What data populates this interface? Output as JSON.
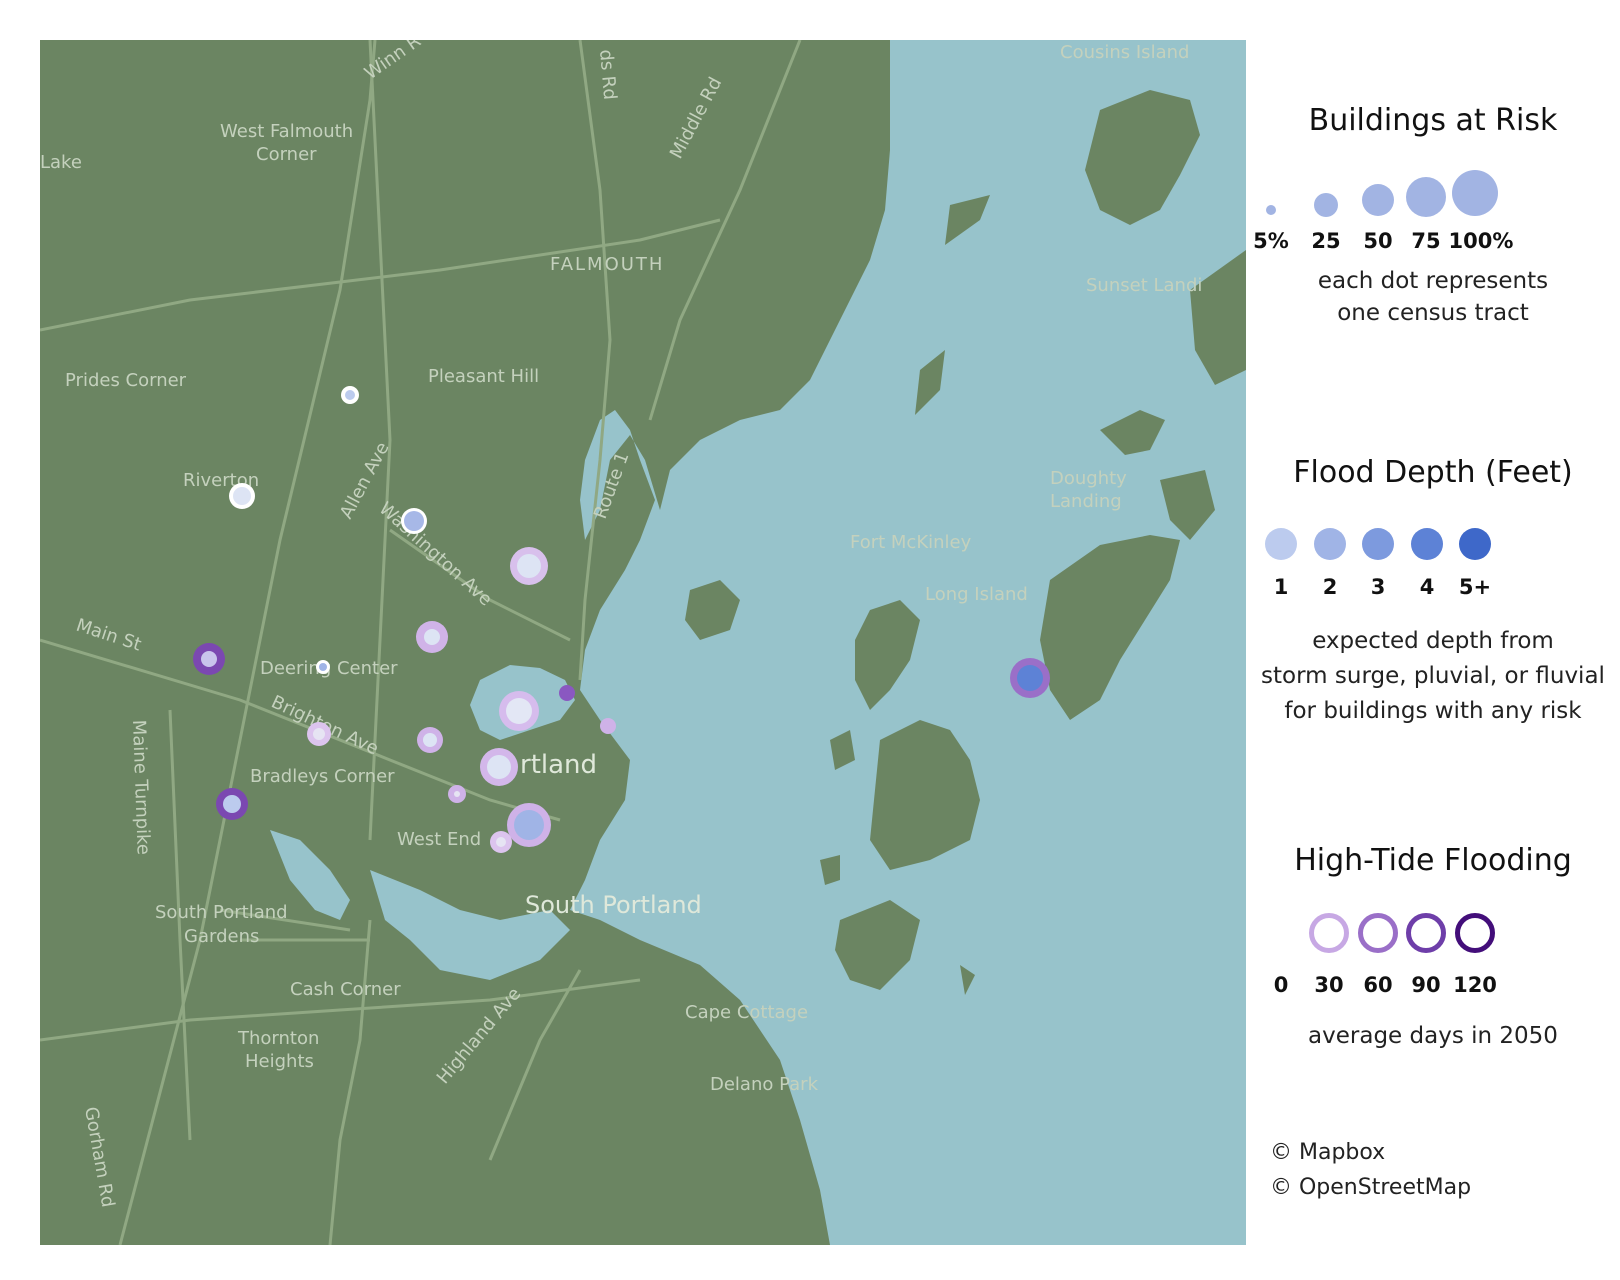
{
  "map": {
    "colors": {
      "land": "#6b8562",
      "water": "#97c3cb",
      "road": "#90a883",
      "label": "#c4d1bd"
    },
    "place_labels": [
      {
        "id": "winn",
        "text": "Winn R"
      },
      {
        "id": "ds-rd",
        "text": "ds Rd"
      },
      {
        "id": "middle-rd",
        "text": "Middle Rd"
      },
      {
        "id": "cousins",
        "text": "Cousins Island"
      },
      {
        "id": "west-falmouth-1",
        "text": "West Falmouth"
      },
      {
        "id": "west-falmouth-2",
        "text": "Corner"
      },
      {
        "id": "lake",
        "text": "Lake"
      },
      {
        "id": "falmouth",
        "text": "FALMOUTH"
      },
      {
        "id": "sunset",
        "text": "Sunset Landi"
      },
      {
        "id": "prides",
        "text": "Prides Corner"
      },
      {
        "id": "pleasant-hill",
        "text": "Pleasant Hill"
      },
      {
        "id": "riverton",
        "text": "Riverton"
      },
      {
        "id": "allen-ave",
        "text": "Allen Ave"
      },
      {
        "id": "washington-ave",
        "text": "Washington Ave"
      },
      {
        "id": "route-1",
        "text": "Route 1"
      },
      {
        "id": "doughty-1",
        "text": "Doughty"
      },
      {
        "id": "doughty-2",
        "text": "Landing"
      },
      {
        "id": "fort-mckinley",
        "text": "Fort McKinley"
      },
      {
        "id": "long-island",
        "text": "Long Island"
      },
      {
        "id": "main-st",
        "text": "Main St"
      },
      {
        "id": "deering",
        "text": "Deering Center"
      },
      {
        "id": "brighton",
        "text": "Brighton Ave"
      },
      {
        "id": "maine-turnpike",
        "text": "Maine Turnpike"
      },
      {
        "id": "portland",
        "text": "rtland"
      },
      {
        "id": "bradleys",
        "text": "Bradleys Corner"
      },
      {
        "id": "west-end",
        "text": "West End"
      },
      {
        "id": "south-portland",
        "text": "South Portland"
      },
      {
        "id": "spg-1",
        "text": "South Portland"
      },
      {
        "id": "spg-2",
        "text": "Gardens"
      },
      {
        "id": "cash",
        "text": "Cash Corner"
      },
      {
        "id": "cape",
        "text": "Cape Cottage"
      },
      {
        "id": "thornton-1",
        "text": "Thornton"
      },
      {
        "id": "thornton-2",
        "text": "Heights"
      },
      {
        "id": "highland",
        "text": "Highland Ave"
      },
      {
        "id": "delano",
        "text": "Delano Park"
      },
      {
        "id": "gorham",
        "text": "Gorham Rd"
      }
    ]
  },
  "legend": {
    "buildings": {
      "title": "Buildings at Risk",
      "labels": [
        "5%",
        "25",
        "50",
        "75",
        "100%"
      ],
      "note_line1": "each dot represents",
      "note_line2": "one census tract",
      "color": "#a2b4e3"
    },
    "depth": {
      "title": "Flood Depth (Feet)",
      "labels": [
        "1",
        "2",
        "3",
        "4",
        "5+"
      ],
      "colors": [
        "#bccbee",
        "#a0b4e6",
        "#7d9ade",
        "#5d82d6",
        "#3e68c9"
      ],
      "note_line1": "expected depth from",
      "note_line2": "storm surge, pluvial, or fluvial",
      "note_line3": "for buildings with any risk"
    },
    "tide": {
      "title": "High-Tide Flooding",
      "labels": [
        "0",
        "30",
        "60",
        "90",
        "120"
      ],
      "colors": [
        "#c7a8e4",
        "#9a6fc8",
        "#6e3ea9",
        "#430e7a"
      ],
      "note": "average days in 2050"
    }
  },
  "credits": {
    "mapbox": "© Mapbox",
    "osm": "© OpenStreetMap"
  }
}
